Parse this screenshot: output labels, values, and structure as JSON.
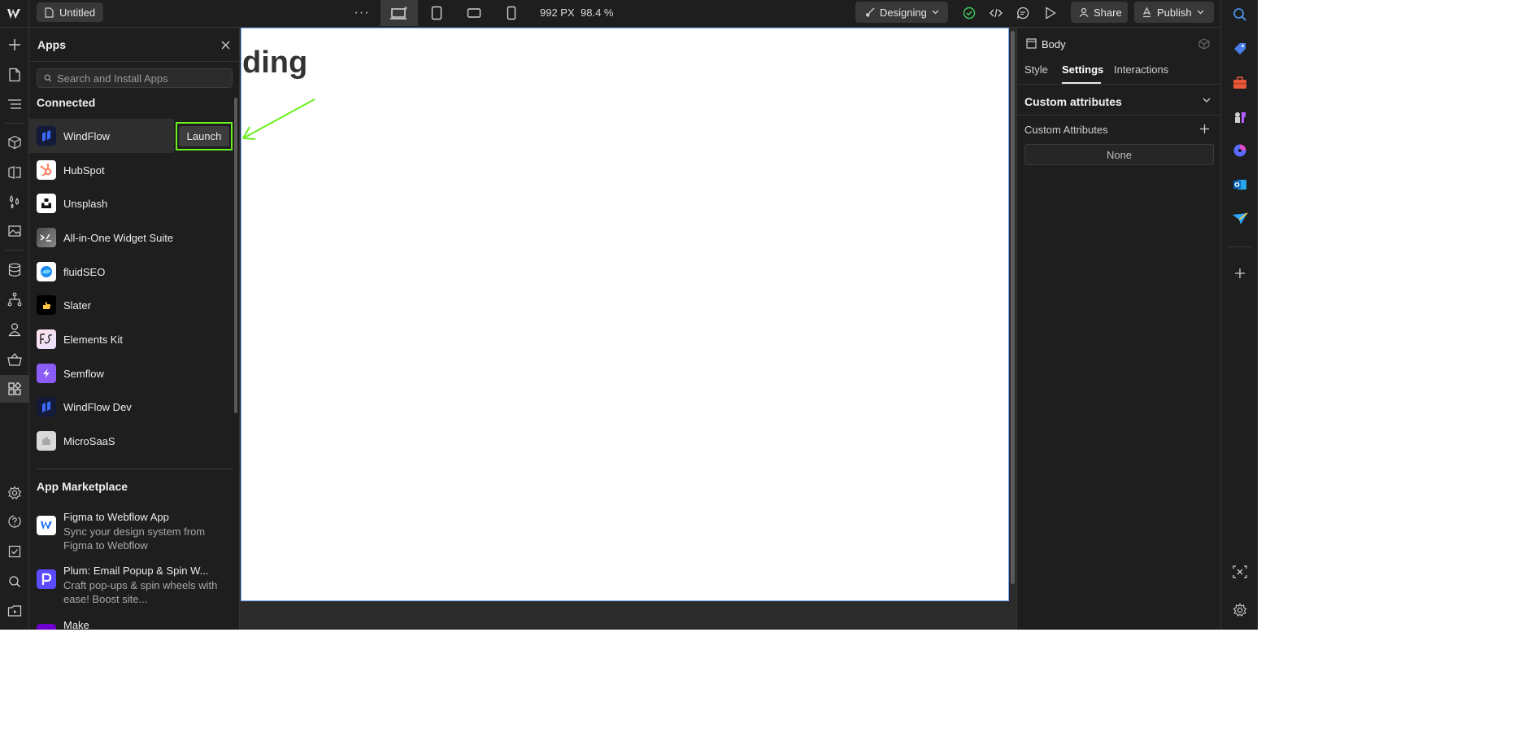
{
  "topbar": {
    "page_name": "Untitled",
    "more_label": "···",
    "canvas_width": "992 PX",
    "zoom": "98.4 %",
    "mode_label": "Designing",
    "share_label": "Share",
    "publish_label": "Publish"
  },
  "apps_panel": {
    "title": "Apps",
    "search_placeholder": "Search and Install Apps",
    "connected_title": "Connected",
    "launch_label": "Launch",
    "connected_apps": [
      {
        "name": "WindFlow",
        "icon": "windflow-logo-icon"
      },
      {
        "name": "HubSpot",
        "icon": "hubspot-logo-icon"
      },
      {
        "name": "Unsplash",
        "icon": "unsplash-logo-icon"
      },
      {
        "name": "All-in-One Widget Suite",
        "icon": "widget-suite-logo-icon"
      },
      {
        "name": "fluidSEO",
        "icon": "fluidseo-logo-icon"
      },
      {
        "name": "Slater",
        "icon": "slater-logo-icon"
      },
      {
        "name": "Elements Kit",
        "icon": "elements-kit-logo-icon"
      },
      {
        "name": "Semflow",
        "icon": "semflow-logo-icon"
      },
      {
        "name": "WindFlow Dev",
        "icon": "windflow-dev-logo-icon"
      },
      {
        "name": "MicroSaaS",
        "icon": "microsaas-logo-icon"
      }
    ],
    "marketplace_title": "App Marketplace",
    "marketplace_apps": [
      {
        "name": "Figma to Webflow App",
        "desc": "Sync your design system from Figma to Webflow"
      },
      {
        "name": "Plum: Email Popup & Spin W...",
        "desc": "Craft pop-ups & spin wheels with ease! Boost site..."
      },
      {
        "name": "Make",
        "desc": ""
      }
    ]
  },
  "canvas": {
    "heading": "ding"
  },
  "right_panel": {
    "element_name": "Body",
    "tabs": [
      "Style",
      "Settings",
      "Interactions"
    ],
    "active_tab": "Settings",
    "section_title": "Custom attributes",
    "attributes_label": "Custom Attributes",
    "empty_value": "None"
  },
  "colors": {
    "highlight": "#6cf01e",
    "accent_check": "#3ecf5a",
    "canvas_border": "#7aaeff"
  }
}
